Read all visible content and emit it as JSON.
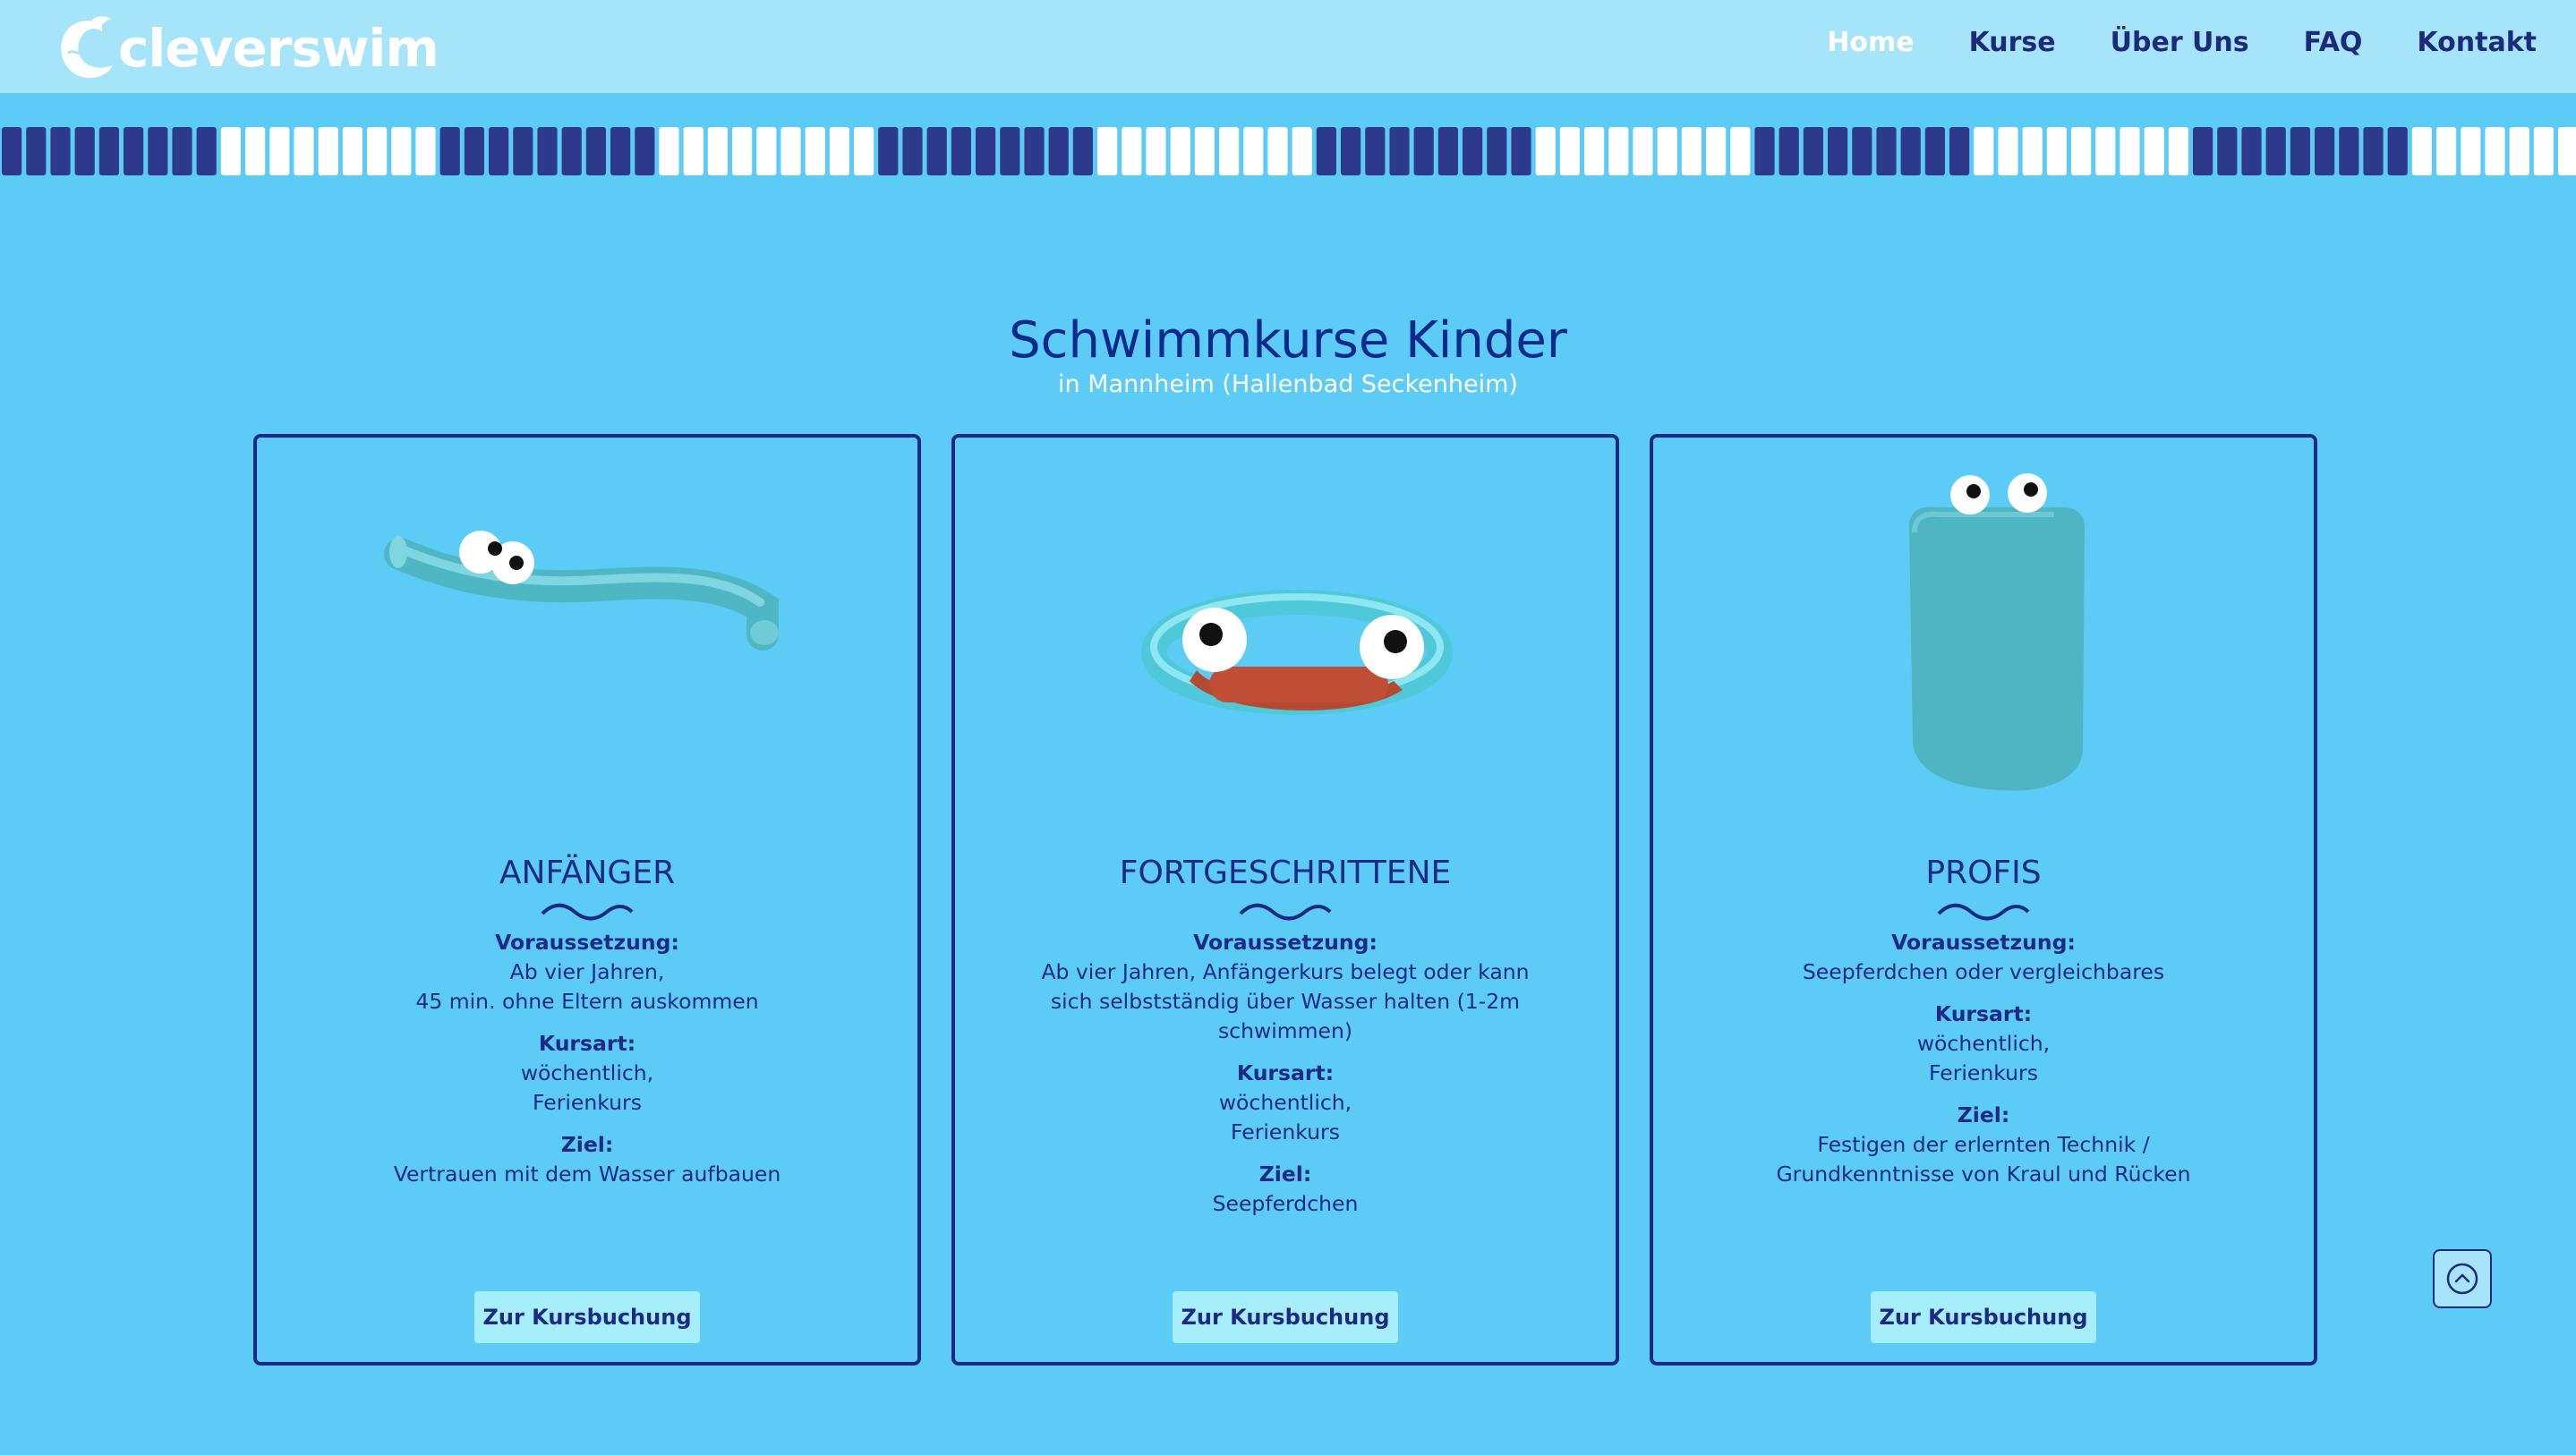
{
  "header": {
    "logo_text": "cleverswim",
    "nav": [
      {
        "label": "Home",
        "active": true
      },
      {
        "label": "Kurse",
        "active": false
      },
      {
        "label": "Über Uns",
        "active": false
      },
      {
        "label": "FAQ",
        "active": false
      },
      {
        "label": "Kontakt",
        "active": false
      }
    ]
  },
  "main": {
    "title": "Schwimmkurse Kinder",
    "subtitle": "in Mannheim (Hallenbad Seckenheim)"
  },
  "cards": [
    {
      "title": "ANFÄNGER",
      "illustration": "pool-noodle-with-eyes",
      "sections": [
        {
          "label": "Voraussetzung:",
          "lines": [
            "Ab vier Jahren,",
            "45 min. ohne Eltern auskommen"
          ]
        },
        {
          "label": "Kursart:",
          "lines": [
            "wöchentlich,",
            "Ferienkurs"
          ]
        },
        {
          "label": "Ziel:",
          "lines": [
            "Vertrauen mit dem Wasser aufbauen"
          ]
        }
      ],
      "button": "Zur Kursbuchung"
    },
    {
      "title": "FORTGESCHRITTENE",
      "illustration": "swim-ring-with-eyes",
      "sections": [
        {
          "label": "Voraussetzung:",
          "lines": [
            "Ab vier Jahren, Anfängerkurs belegt oder kann",
            "sich selbstständig über Wasser halten (1-2m",
            "schwimmen)"
          ]
        },
        {
          "label": "Kursart:",
          "lines": [
            "wöchentlich,",
            "Ferienkurs"
          ]
        },
        {
          "label": "Ziel:",
          "lines": [
            "Seepferdchen"
          ]
        }
      ],
      "button": "Zur Kursbuchung"
    },
    {
      "title": "PROFIS",
      "illustration": "kickboard-with-eyes",
      "sections": [
        {
          "label": "Voraussetzung:",
          "lines": [
            "Seepferdchen oder vergleichbares"
          ]
        },
        {
          "label": "Kursart:",
          "lines": [
            "wöchentlich,",
            "Ferienkurs"
          ]
        },
        {
          "label": "Ziel:",
          "lines": [
            "Festigen der erlernten Technik /",
            "Grundkenntnisse von Kraul und Rücken"
          ]
        }
      ],
      "button": "Zur Kursbuchung"
    }
  ],
  "scroll_top_icon": "chevron-up-circle-icon",
  "colors": {
    "background": "#5ccbf5",
    "header": "#a6e4fa",
    "navy": "#1c2a86",
    "button": "#a6eefc"
  }
}
